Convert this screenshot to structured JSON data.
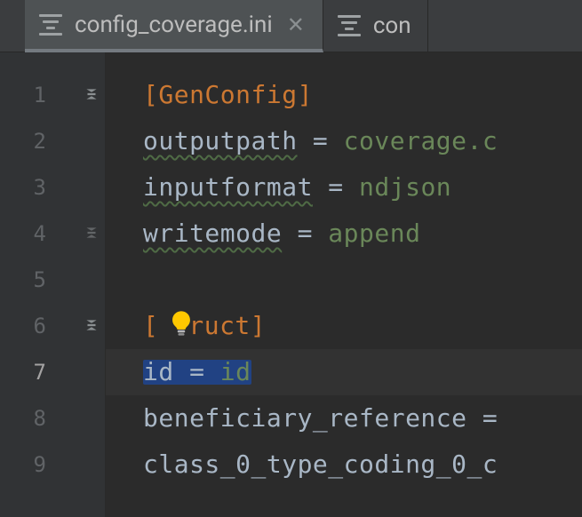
{
  "tabs": {
    "active": {
      "filename": "config_coverage.ini"
    },
    "next": {
      "filename_visible": "con"
    }
  },
  "editor": {
    "lines": {
      "1": {
        "n": "1",
        "section": "[GenConfig]"
      },
      "2": {
        "n": "2",
        "key": "outputpath",
        "eq": " = ",
        "val": "coverage.c"
      },
      "3": {
        "n": "3",
        "key": "inputformat",
        "eq": " = ",
        "val": "ndjson"
      },
      "4": {
        "n": "4",
        "key": "writemode",
        "eq": " = ",
        "val": "append"
      },
      "5": {
        "n": "5"
      },
      "6": {
        "n": "6",
        "section_hidden_by_bulb": "[ ruct]",
        "section_left": "[",
        "section_right": "ruct]"
      },
      "7": {
        "n": "7",
        "key": "id",
        "eq": " = ",
        "val": "id"
      },
      "8": {
        "n": "8",
        "key": "beneficiary_reference",
        "eq": " ="
      },
      "9": {
        "n": "9",
        "key": "class_0_type_coding_0_c"
      }
    },
    "caret_line": 7
  },
  "icons": {
    "file_ini": "ini-file-icon",
    "close": "close-icon",
    "fold_collapse": "fold-minus-icon",
    "lightbulb": "lightbulb-hint-icon"
  },
  "colors": {
    "accent_orange": "#cc7832",
    "accent_green": "#6a8759",
    "selection": "#214283",
    "hint_yellow": "#ffc800"
  }
}
